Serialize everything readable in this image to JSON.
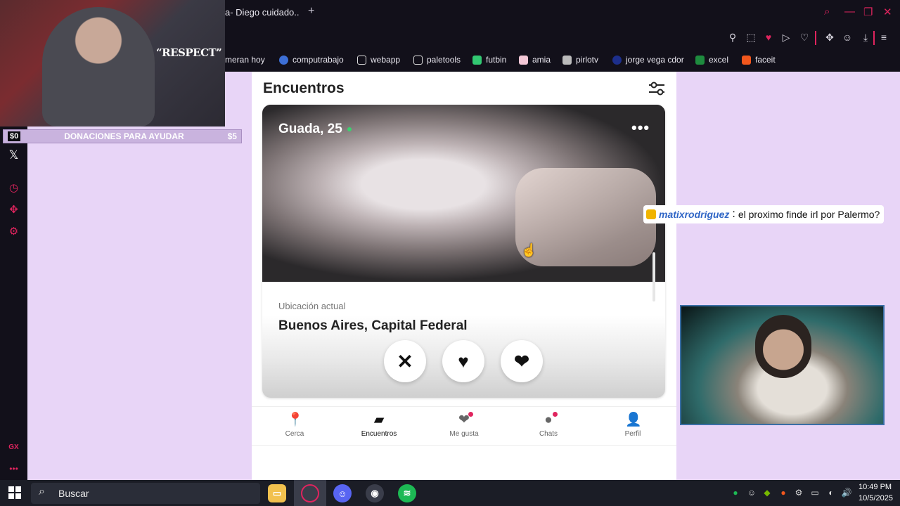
{
  "browser": {
    "tab_title": "a- Diego cuidado..",
    "new_tab": "+",
    "window_controls": {
      "search": "⌕",
      "minimize": "—",
      "restore": "❐",
      "close": "✕"
    },
    "toolbar_icons": [
      "pin-icon",
      "snapshot-icon",
      "pocket-icon",
      "play-icon",
      "heart-icon",
      "extensions-icon",
      "account-icon",
      "download-icon",
      "menu-icon"
    ],
    "accent_color": "#e0245e"
  },
  "bookmarks": [
    {
      "label": "meran hoy",
      "icon": ""
    },
    {
      "label": "computrabajo",
      "icon": "computrabajo-icon"
    },
    {
      "label": "webapp",
      "icon": "page-icon"
    },
    {
      "label": "paletools",
      "icon": "page-icon"
    },
    {
      "label": "futbin",
      "icon": "futbin-icon"
    },
    {
      "label": "amia",
      "icon": "amia-icon"
    },
    {
      "label": "pirlotv",
      "icon": "pirlotv-icon"
    },
    {
      "label": "jorge vega cdor",
      "icon": "jorge-icon"
    },
    {
      "label": "excel",
      "icon": "excel-icon"
    },
    {
      "label": "faceit",
      "icon": "faceit-icon"
    }
  ],
  "stream_overlay": {
    "respect_text": "“RESPECT”",
    "donation": {
      "left_amount": "$0",
      "title": "DONACIONES PARA AYUDAR",
      "right_amount": "$5"
    },
    "chat": {
      "username": "matixrodriguez",
      "separator": ":",
      "message": "el proximo finde irl por Palermo?"
    }
  },
  "app": {
    "title": "Encuentros",
    "card": {
      "name_age": "Guada, 25",
      "more": "•••",
      "location_label": "Ubicación actual",
      "location": "Buenos Aires, Capital Federal"
    },
    "actions": {
      "dislike": "✕",
      "superlike": "♥",
      "like": "❤"
    },
    "nav": [
      {
        "label": "Cerca",
        "icon": "location-pin-icon",
        "glyph": "📍",
        "badge": false
      },
      {
        "label": "Encuentros",
        "icon": "cards-icon",
        "glyph": "▰",
        "badge": false,
        "active": true
      },
      {
        "label": "Me gusta",
        "icon": "likes-icon",
        "glyph": "❤",
        "badge": true
      },
      {
        "label": "Chats",
        "icon": "chat-icon",
        "glyph": "●",
        "badge": true
      },
      {
        "label": "Perfil",
        "icon": "profile-icon",
        "glyph": "👤",
        "badge": false
      }
    ]
  },
  "taskbar": {
    "search_placeholder": "Buscar",
    "time": "10:49 PM",
    "date": "10/5/2025"
  }
}
